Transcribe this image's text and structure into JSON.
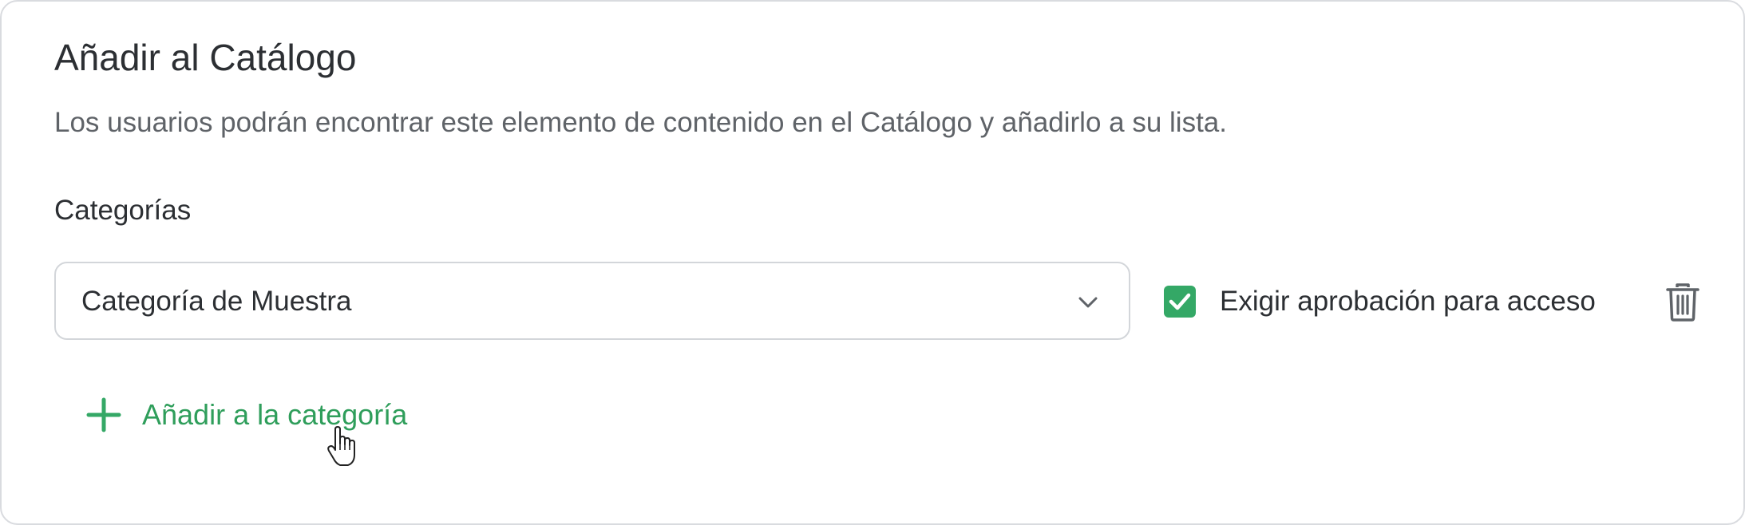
{
  "panel": {
    "title": "Añadir al Catálogo",
    "description": "Los usuarios podrán encontrar este elemento de contenido en el Catálogo y añadirlo a su lista."
  },
  "categories": {
    "label": "Categorías",
    "selected_value": "Categoría de Muestra",
    "require_approval": {
      "label": "Exigir aprobación para acceso",
      "checked": true
    },
    "add_button_label": "Añadir a la categoría"
  },
  "icons": {
    "dropdown": "chevron-down-icon",
    "delete": "trash-icon",
    "add": "plus-icon",
    "checkbox": "checkmark-icon",
    "pointer": "hand-cursor-icon"
  },
  "colors": {
    "accent_green": "#34a866",
    "add_text_green": "#2f9e5b",
    "border": "#d3d6da",
    "text_primary": "#2c2f33",
    "text_secondary": "#5f6368"
  }
}
